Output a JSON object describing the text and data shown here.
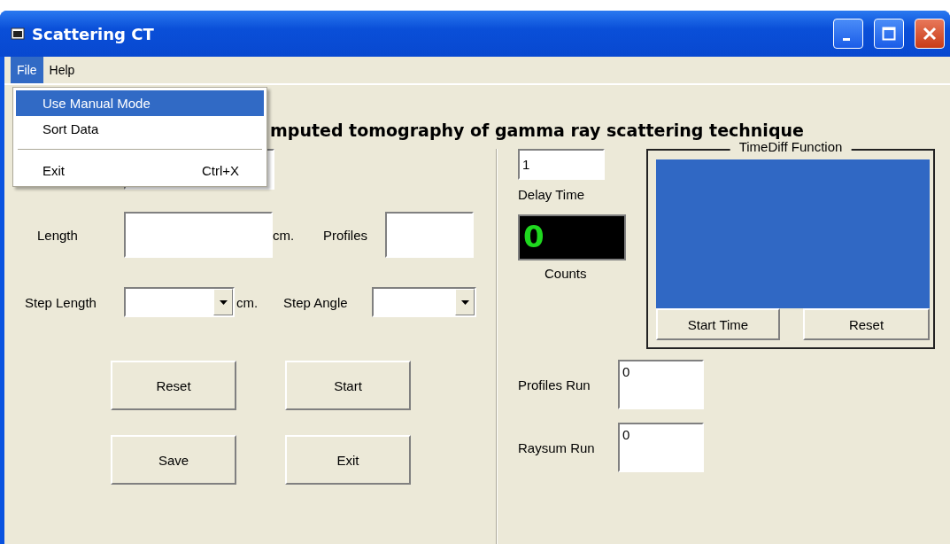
{
  "window": {
    "title": "Scattering CT"
  },
  "menu_bar": [
    {
      "label": "File",
      "selected": true
    },
    {
      "label": "Help",
      "selected": false
    }
  ],
  "open_menu": [
    {
      "kind": "item",
      "label": "Use Manual Mode",
      "selected": true
    },
    {
      "kind": "item",
      "label": "Sort Data",
      "selected": false
    },
    {
      "kind": "separator"
    },
    {
      "kind": "item",
      "label": "Exit",
      "shortcut": "Ctrl+X",
      "selected": false
    }
  ],
  "heading": "mputed tomography of gamma ray scattering technique",
  "length": {
    "label": "Length",
    "unit": "cm."
  },
  "profiles": {
    "label": "Profiles"
  },
  "step_length": {
    "label": "Step Length",
    "unit": "cm."
  },
  "step_angle": {
    "label": "Step Angle"
  },
  "buttons": [
    "Reset",
    "Start",
    "Save",
    "Exit"
  ],
  "delay": {
    "value": "1",
    "label": "Delay Time"
  },
  "counts": {
    "value": "0",
    "label": "Counts"
  },
  "timediff": {
    "title": "TimeDiff Function",
    "buttons": [
      "Start Time",
      "Reset"
    ]
  },
  "runs": [
    {
      "label": "Profiles Run",
      "value": "0"
    },
    {
      "label": "Raysum Run",
      "value": "0"
    }
  ]
}
